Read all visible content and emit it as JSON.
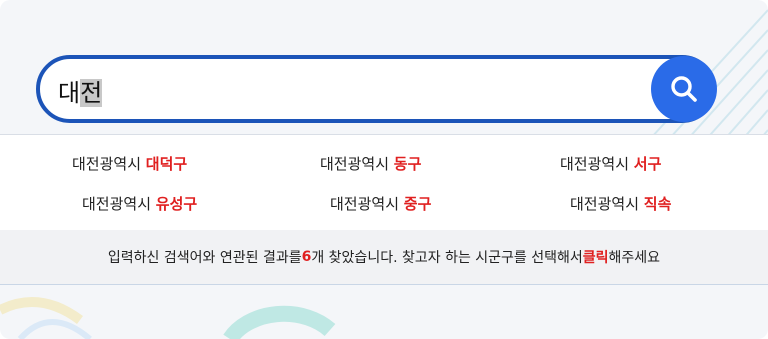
{
  "search": {
    "value_plain": "대",
    "value_selected": "전"
  },
  "results": [
    {
      "prefix": "대전광역시",
      "district": "대덕구"
    },
    {
      "prefix": "대전광역시",
      "district": "동구"
    },
    {
      "prefix": "대전광역시",
      "district": "서구"
    },
    {
      "prefix": "대전광역시",
      "district": "유성구"
    },
    {
      "prefix": "대전광역시",
      "district": "중구"
    },
    {
      "prefix": "대전광역시",
      "district": "직속"
    }
  ],
  "notice": {
    "before_count": "입력하신 검색어와 연관된 결과를 ",
    "count": "6",
    "middle": "개 찾았습니다. 찾고자 하는 시군구를 선택해서 ",
    "click_word": "클릭",
    "after": "해주세요"
  },
  "colors": {
    "accent_border": "#1c54b8",
    "button": "#2a6be8",
    "highlight": "#e02020"
  },
  "icons": {
    "search_button": "search-icon"
  }
}
